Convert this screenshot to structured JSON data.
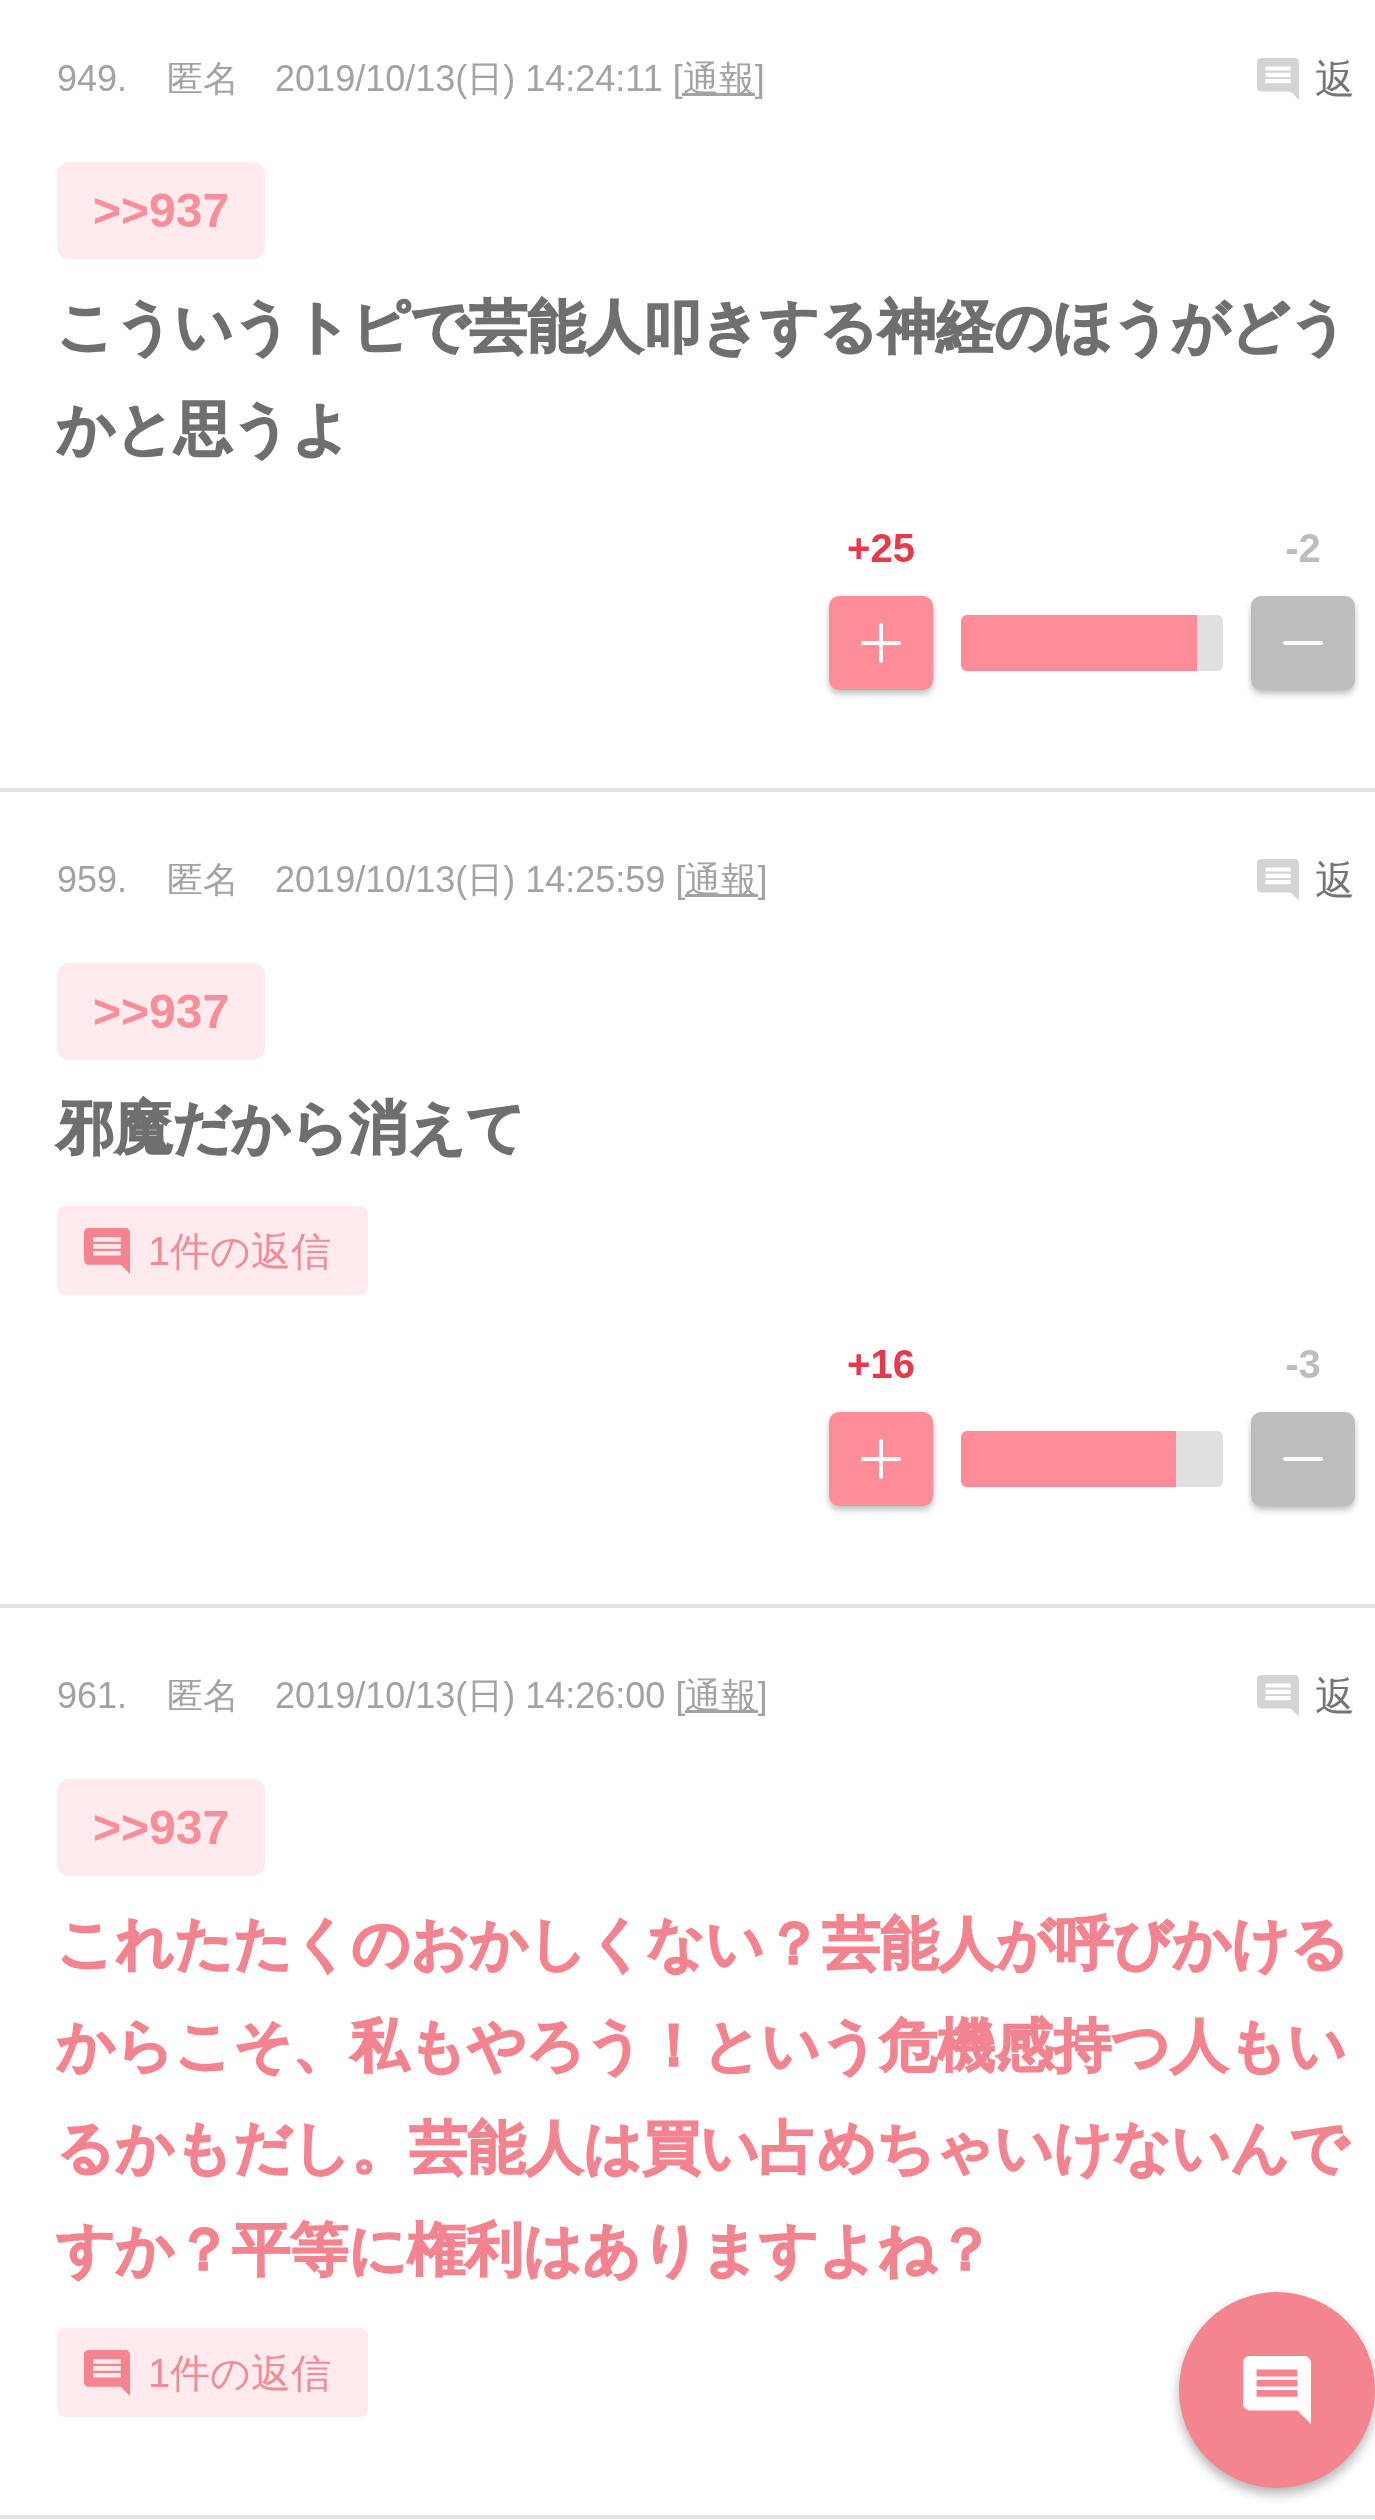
{
  "posts": [
    {
      "number": "949.",
      "author": "匿名",
      "date": "2019/10/13(日) 14:24:11",
      "report_link": "[通報]",
      "reply_button": "返",
      "quote": ">>937",
      "body": "こういうトピで芸能人叩きする神経のほうがどうかと思うよ",
      "highlighted": false,
      "votes": {
        "plus": "+25",
        "minus": "-2",
        "level": 0.9
      }
    },
    {
      "number": "959.",
      "author": "匿名",
      "date": "2019/10/13(日) 14:25:59",
      "report_link": "[通報]",
      "reply_button": "返",
      "quote": ">>937",
      "body": "邪魔だから消えて",
      "highlighted": false,
      "replies": "1件の返信",
      "votes": {
        "plus": "+16",
        "minus": "-3",
        "level": 0.82
      }
    },
    {
      "number": "961.",
      "author": "匿名",
      "date": "2019/10/13(日) 14:26:00",
      "report_link": "[通報]",
      "reply_button": "返",
      "quote": ">>937",
      "body": "これたたくのおかしくない？芸能人が呼びかけるからこそ、私もやろう！という危機感持つ人もいるかもだし。芸能人は買い占めちゃいけないんですか？平等に権利はありますよね？",
      "highlighted": true,
      "replies": "1件の返信"
    }
  ]
}
